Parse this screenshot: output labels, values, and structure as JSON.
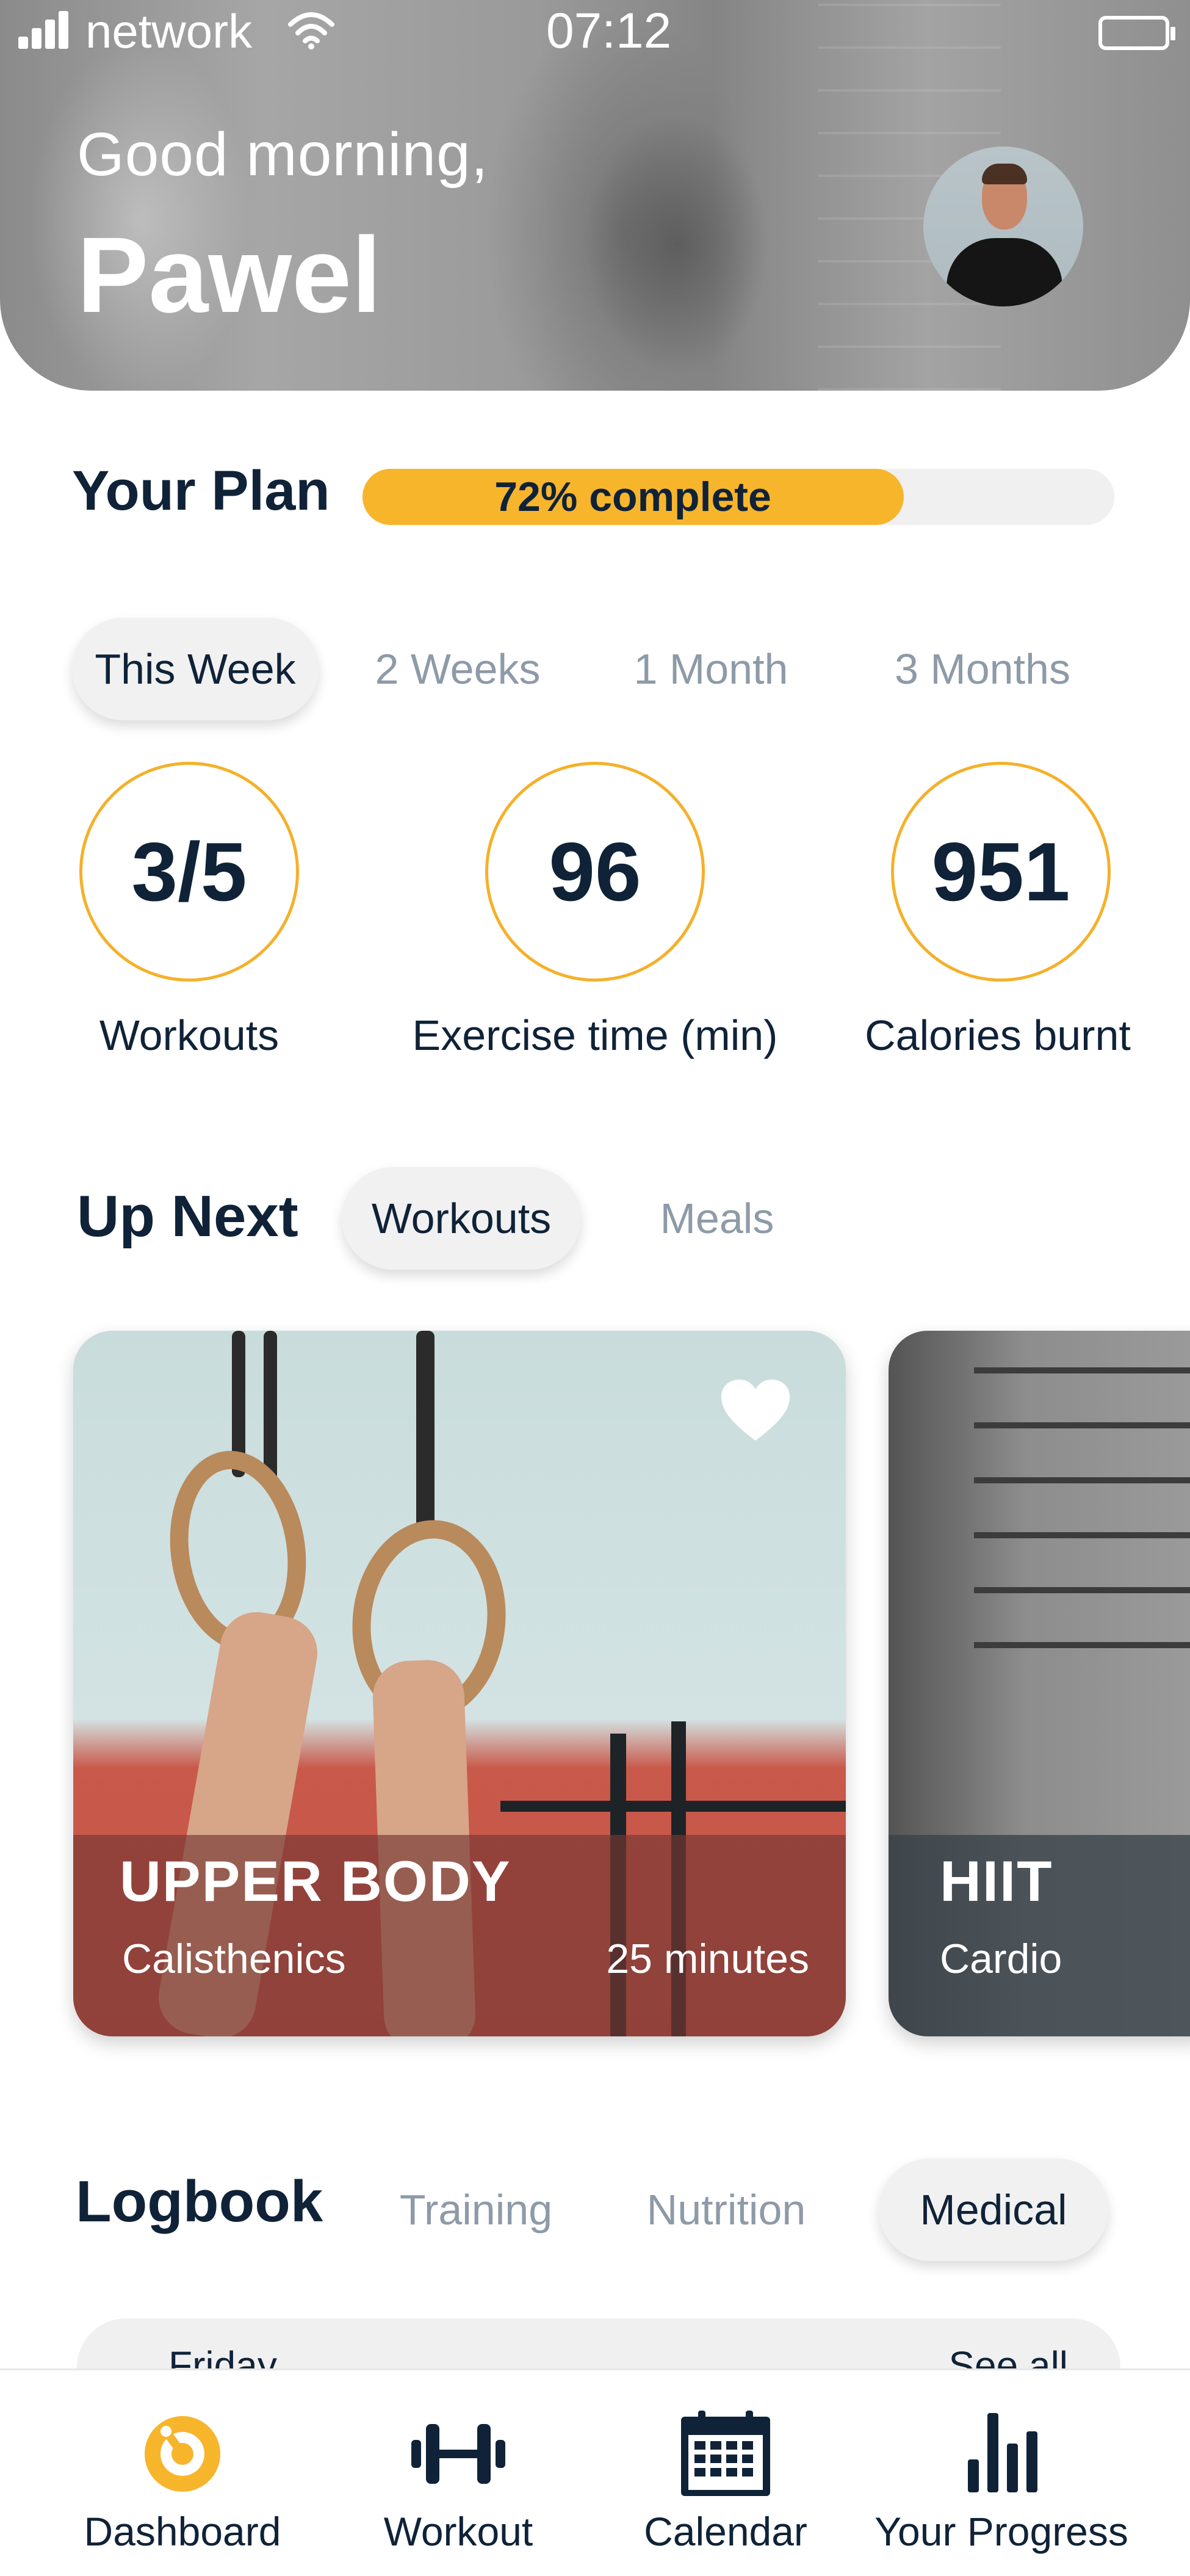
{
  "status_bar": {
    "network": "network",
    "time": "07:12"
  },
  "header": {
    "greeting": "Good morning,",
    "name": "Pawel"
  },
  "plan": {
    "title": "Your Plan",
    "progress_percent": 72,
    "progress_label": "72% complete"
  },
  "period_tabs": [
    {
      "label": "This Week",
      "active": true
    },
    {
      "label": "2 Weeks",
      "active": false
    },
    {
      "label": "1 Month",
      "active": false
    },
    {
      "label": "3 Months",
      "active": false
    }
  ],
  "stats": [
    {
      "value": "3/5",
      "label": "Workouts"
    },
    {
      "value": "96",
      "label": "Exercise time (min)"
    },
    {
      "value": "951",
      "label": "Calories burnt"
    }
  ],
  "up_next": {
    "title": "Up Next",
    "tabs": [
      {
        "label": "Workouts",
        "active": true
      },
      {
        "label": "Meals",
        "active": false
      }
    ],
    "cards": [
      {
        "title": "UPPER BODY",
        "category": "Calisthenics",
        "duration": "25 minutes"
      },
      {
        "title": "HIIT",
        "category": "Cardio"
      }
    ]
  },
  "logbook": {
    "title": "Logbook",
    "tabs": [
      {
        "label": "Training",
        "active": false
      },
      {
        "label": "Nutrition",
        "active": false
      },
      {
        "label": "Medical",
        "active": true
      }
    ],
    "preview": {
      "day": "Friday",
      "action": "See all"
    }
  },
  "bottom_nav": [
    {
      "label": "Dashboard",
      "icon": "dashboard-icon",
      "active": true
    },
    {
      "label": "Workout",
      "icon": "dumbbell-icon",
      "active": false
    },
    {
      "label": "Calendar",
      "icon": "calendar-icon",
      "active": false
    },
    {
      "label": "Your Progress",
      "icon": "bar-chart-icon",
      "active": false
    }
  ],
  "colors": {
    "accent": "#f7b52c",
    "primary_text": "#0f2238",
    "muted_text": "#8e9aa8"
  }
}
